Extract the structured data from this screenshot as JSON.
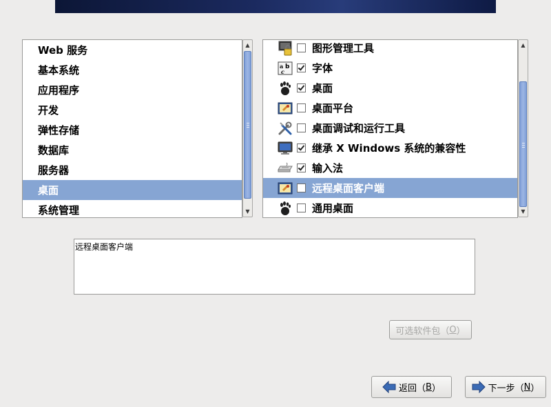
{
  "categories": [
    {
      "label": "Web 服务",
      "selected": false
    },
    {
      "label": "基本系统",
      "selected": false
    },
    {
      "label": "应用程序",
      "selected": false
    },
    {
      "label": "开发",
      "selected": false
    },
    {
      "label": "弹性存储",
      "selected": false
    },
    {
      "label": "数据库",
      "selected": false
    },
    {
      "label": "服务器",
      "selected": false
    },
    {
      "label": "桌面",
      "selected": true
    },
    {
      "label": "系统管理",
      "selected": false
    }
  ],
  "packages": [
    {
      "label": "图形管理工具",
      "checked": false,
      "icon": "lock-monitor-icon",
      "selected": false
    },
    {
      "label": "字体",
      "checked": true,
      "icon": "font-icon",
      "selected": false
    },
    {
      "label": "桌面",
      "checked": true,
      "icon": "gnome-foot-icon",
      "selected": false
    },
    {
      "label": "桌面平台",
      "checked": false,
      "icon": "desktop-platform-icon",
      "selected": false
    },
    {
      "label": "桌面调试和运行工具",
      "checked": false,
      "icon": "tools-icon",
      "selected": false
    },
    {
      "label": "继承 X Windows 系统的兼容性",
      "checked": true,
      "icon": "monitor-icon",
      "selected": false
    },
    {
      "label": "输入法",
      "checked": true,
      "icon": "keyboard-icon",
      "selected": false
    },
    {
      "label": "远程桌面客户端",
      "checked": false,
      "icon": "desktop-platform-icon",
      "selected": true
    },
    {
      "label": "通用桌面",
      "checked": false,
      "icon": "gnome-foot-icon",
      "selected": false
    }
  ],
  "description": "远程桌面客户端",
  "buttons": {
    "optional_label": "可选软件包（",
    "optional_key": "O",
    "optional_close": "）",
    "back_label": "返回（",
    "back_key": "B",
    "back_close": "）",
    "next_label": "下一步（",
    "next_key": "N",
    "next_close": "）"
  },
  "colors": {
    "selection": "#86a5d3",
    "background": "#edeceb"
  }
}
